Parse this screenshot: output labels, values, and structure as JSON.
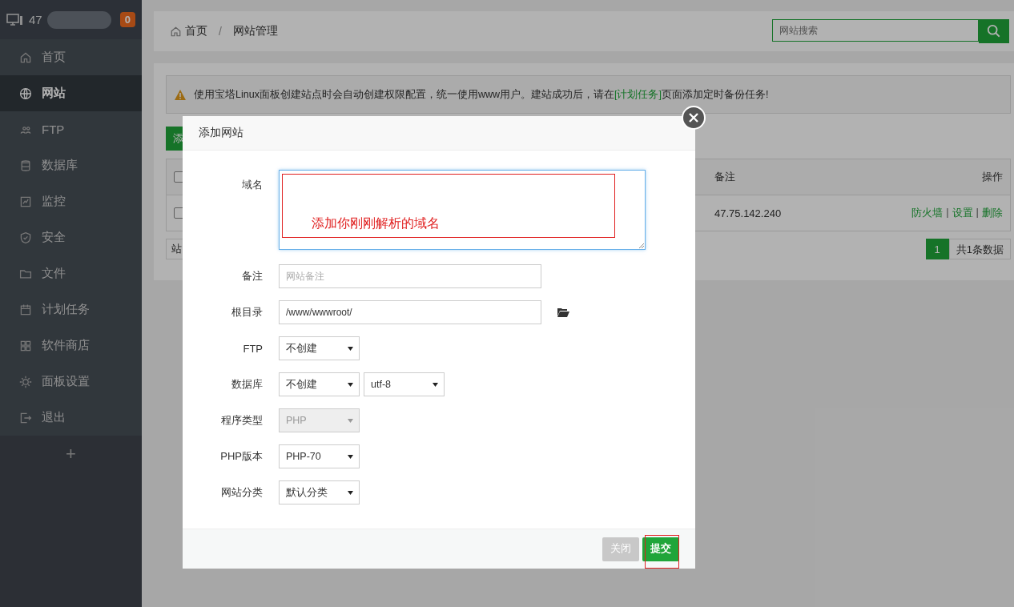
{
  "sidebar": {
    "host": "47",
    "badge": "0",
    "items": [
      {
        "label": "首页",
        "selected": false
      },
      {
        "label": "网站",
        "selected": true
      },
      {
        "label": "FTP",
        "selected": false
      },
      {
        "label": "数据库",
        "selected": false
      },
      {
        "label": "监控",
        "selected": false
      },
      {
        "label": "安全",
        "selected": false
      },
      {
        "label": "文件",
        "selected": false
      },
      {
        "label": "计划任务",
        "selected": false
      },
      {
        "label": "软件商店",
        "selected": false
      },
      {
        "label": "面板设置",
        "selected": false
      },
      {
        "label": "退出",
        "selected": false
      }
    ],
    "add": "+"
  },
  "breadcrumb": [
    "首页",
    "网站管理"
  ],
  "breadcrumb_separator": "/",
  "search": {
    "placeholder": "网站搜索"
  },
  "notice": {
    "before": "使用宝塔Linux面板创建站点时会自动创建权限配置，统一使用www用户。建站成功后，请在",
    "link": "[计划任务]",
    "after": "页面添加定时备份任务!"
  },
  "add_button": "添",
  "table": {
    "header_checked": false,
    "columns": [
      "备注",
      "操作"
    ],
    "rows": [
      {
        "checked": false,
        "remark": "47.75.142.240",
        "actions": [
          "防火墙",
          "设置",
          "删除"
        ],
        "separator": "|"
      }
    ]
  },
  "table_footer": "站",
  "pagination": {
    "pages": [
      {
        "label": "1",
        "selected": true
      }
    ],
    "total": "共1条数据"
  },
  "modal": {
    "title": "添加网站",
    "fields": [
      {
        "kind": "textarea",
        "label": "域名",
        "annotation": "添加你刚刚解析的域名"
      },
      {
        "kind": "text",
        "label": "备注",
        "placeholder": "网站备注"
      },
      {
        "kind": "text",
        "label": "根目录",
        "value": "/www/wwwroot/",
        "folder": true
      },
      {
        "kind": "select",
        "label": "FTP",
        "selects": [
          {
            "value": "不创建",
            "disabled": false
          }
        ]
      },
      {
        "kind": "select",
        "label": "数据库",
        "selects": [
          {
            "value": "不创建",
            "disabled": false
          },
          {
            "value": "utf-8",
            "disabled": false
          }
        ]
      },
      {
        "kind": "select",
        "label": "程序类型",
        "selects": [
          {
            "value": "PHP",
            "disabled": true
          }
        ]
      },
      {
        "kind": "select",
        "label": "PHP版本",
        "selects": [
          {
            "value": "PHP-70",
            "disabled": false
          }
        ]
      },
      {
        "kind": "select",
        "label": "网站分类",
        "selects": [
          {
            "value": "默认分类",
            "disabled": false
          }
        ]
      }
    ],
    "buttons": [
      {
        "kind": "close",
        "label": "关闭",
        "highlighted": false
      },
      {
        "kind": "submit",
        "label": "提交",
        "highlighted": true
      }
    ]
  }
}
